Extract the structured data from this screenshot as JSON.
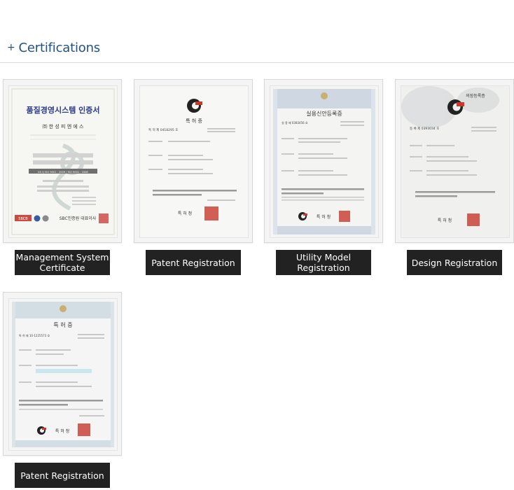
{
  "section": {
    "title": "Certifications"
  },
  "certificates": [
    {
      "label_line1": "Management System",
      "label_line2": "Certificate",
      "doc_title": "품질경영시스템 인증서",
      "doc_company": "㈜ 한 성 피 엔 에 스",
      "doc_footer": "SBC인증원 대표이사",
      "doc_badge": "SBCB",
      "doc_std": "KS Q ISO 9001 : 2009 / ISO 9001 : 2008"
    },
    {
      "label_line1": "Patent Registration",
      "label_line2": "",
      "doc_title": "특 허 증",
      "doc_number": "특 허   제 0418295 호",
      "doc_seal_text": "특 허 청"
    },
    {
      "label_line1": "Utility Model",
      "label_line2": "Registration",
      "doc_title": "실용신안등록증",
      "doc_number": "실 용   제 0383456 호",
      "doc_seal_text": "특 허 청"
    },
    {
      "label_line1": "Design Registration",
      "label_line2": "",
      "doc_title": "의장등록증",
      "doc_number": "등 록   제 0393034 호",
      "doc_seal_text": "특 허 청"
    },
    {
      "label_line1": "Patent Registration",
      "label_line2": "",
      "doc_title": "특 허 증",
      "doc_number": "특 허   제 10-1225573 호",
      "doc_seal_text": "특 허 청"
    }
  ],
  "colors": {
    "heading": "#24527e",
    "label_bg": "#222222",
    "seal_red": "#c8382d"
  }
}
